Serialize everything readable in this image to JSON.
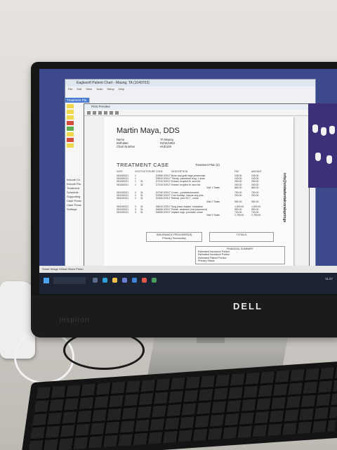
{
  "monitor": {
    "brand": "DELL",
    "model": "Inspiron"
  },
  "app": {
    "title": "Eaglesoft Patient Chart - Maung, TA (1049703)",
    "menu": [
      "File",
      "Edit",
      "View",
      "Tools",
      "Setup",
      "Help"
    ],
    "left_panel_tab": "Treatment Pla",
    "left_labels": [
      "Include Co",
      "Include Pla",
      "Treatment",
      "Schedule",
      "Supporting",
      "Case Prese",
      "Case Prese",
      "Settings"
    ]
  },
  "preview": {
    "title": "Print Preview",
    "doctor": "Martin Maya, DDS",
    "info_labels": [
      "Name",
      "Birthdate",
      "Chart Number"
    ],
    "info_values": [
      "TA Maung",
      "03/15/1983",
      "HUD100"
    ],
    "section_title": "TREATMENT CASE",
    "treatment_plan_label": "Treatment Plan (2)",
    "columns": [
      "DATE",
      "VISIT",
      "TOOTH",
      "SURF",
      "CODE",
      "DESCRIPTION",
      "FEE",
      "AMOUNT"
    ],
    "visits": [
      {
        "rows": [
          {
            "date": "05/18/2021",
            "visit": "1",
            "tooth": "",
            "surf": "",
            "code": "D2950 D2917",
            "desc": "Bone repl graft ridge preservatio",
            "fee": "235.00",
            "amt": "235.00"
          },
          {
            "date": "05/18/2021",
            "visit": "1",
            "tooth": "",
            "surf": "",
            "code": "D9910 D2917",
            "desc": "Therap. parenteral drug, 1 dose",
            "fee": "125.00",
            "amt": "125.00"
          },
          {
            "date": "05/18/2021",
            "visit": "1",
            "tooth": "31",
            "surf": "",
            "code": "D7210 D2917",
            "desc": "Extract, erupted th, sect etc",
            "fee": "250.00",
            "amt": "250.00"
          },
          {
            "date": "05/18/2021",
            "visit": "1",
            "tooth": "32",
            "surf": "",
            "code": "D7210 D2917",
            "desc": "Extract, erupted th, sect etc",
            "fee": "250.00",
            "amt": "250.00"
          }
        ],
        "total_label": "Visit 1 Totals",
        "total_fee": "860.00",
        "total_amt": "860.00"
      },
      {
        "rows": [
          {
            "date": "05/19/2021",
            "visit": "2",
            "tooth": "31",
            "surf": "",
            "code": "D2740 D2917",
            "desc": "Crown - porcelain/ceramic",
            "fee": "750.00",
            "amt": "750.00"
          },
          {
            "date": "05/19/2021",
            "visit": "2",
            "tooth": "31",
            "surf": "",
            "code": "D2950 D2917",
            "desc": "Core buildup, include any pins",
            "fee": "200.00",
            "amt": "200.00"
          },
          {
            "date": "05/19/2021",
            "visit": "2",
            "tooth": "31",
            "surf": "",
            "code": "D2330 D2917",
            "desc": "Retreat. prev RCT - molar",
            "fee": "",
            "amt": ""
          }
        ],
        "total_label": "Visit 2 Totals",
        "total_fee": "950.00",
        "total_amt": "950.00"
      },
      {
        "rows": [
          {
            "date": "05/19/2021",
            "visit": "3",
            "tooth": "31",
            "surf": "",
            "code": "D6010 D2917",
            "desc": "Surg place implant: endosteal",
            "fee": "1,500.00",
            "amt": "1,500.00"
          },
          {
            "date": "05/19/2021",
            "visit": "3",
            "tooth": "31",
            "surf": "",
            "code": "D6056 D2917",
            "desc": "Prefab. abutment (incl placement)",
            "fee": "550.00",
            "amt": "550.00"
          },
          {
            "date": "05/19/2021",
            "visit": "3",
            "tooth": "31",
            "surf": "",
            "code": "D6065 D2917",
            "desc": "Implant supp. porcelain crown",
            "fee": "700.00",
            "amt": "700.00"
          }
        ],
        "total_label": "Visit 3 Totals",
        "total_fee": "2,750.00",
        "total_amt": "2,750.00"
      }
    ],
    "insurance_box": "INSURANCE PROVIDER(S)",
    "insurance_sub": "Primary      Secondary",
    "totals_box": "TOTALS",
    "financial_title": "FINANCIAL SUMMARY",
    "financial_lines": [
      "Estimated Insurance Portion",
      "Estimated Insurance Portion",
      "Estimated Patient Portion",
      "Primary Status"
    ],
    "email": "info@vistadentalcoralsprings",
    "footer_left": "Current Page No: 1",
    "footer_mid": "Total Page No: 1",
    "footer_right": "Zoom Factor: Page Width"
  },
  "statusbar": {
    "text": "Smart Image   Virtual Share   Photo"
  },
  "taskbar": {
    "time": "11:27"
  }
}
